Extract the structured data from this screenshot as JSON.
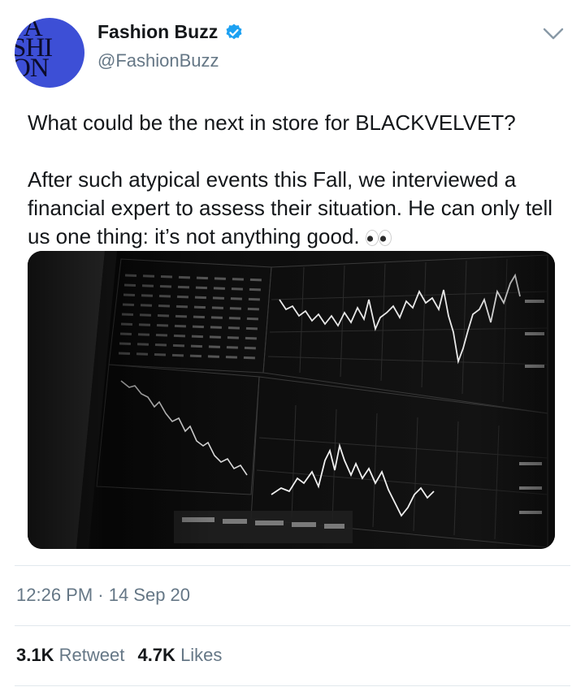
{
  "author": {
    "name": "Fashion Buzz",
    "handle": "@FashionBuzz",
    "avatar_text": [
      "FA",
      "SHI",
      "ON"
    ],
    "avatar_color": "#3d4fd6",
    "verified": true
  },
  "tweet": {
    "line1": "What could be the next in store for BLACKVELVET?",
    "line2": "After such atypical events this Fall, we interviewed a financial expert to assess their situation. He can only tell us one thing: it’s not anything good.",
    "emoji": "eyes-icon",
    "media": "stock-chart-monitor-photo"
  },
  "meta": {
    "timestamp": "12:26 PM · 14 Sep 20"
  },
  "stats": {
    "retweets_count": "3.1K",
    "retweets_label": "Retweet",
    "likes_count": "4.7K",
    "likes_label": "Likes"
  },
  "colors": {
    "accent": "#1da1f2",
    "secondary_text": "#657786",
    "primary_text": "#14171a"
  }
}
